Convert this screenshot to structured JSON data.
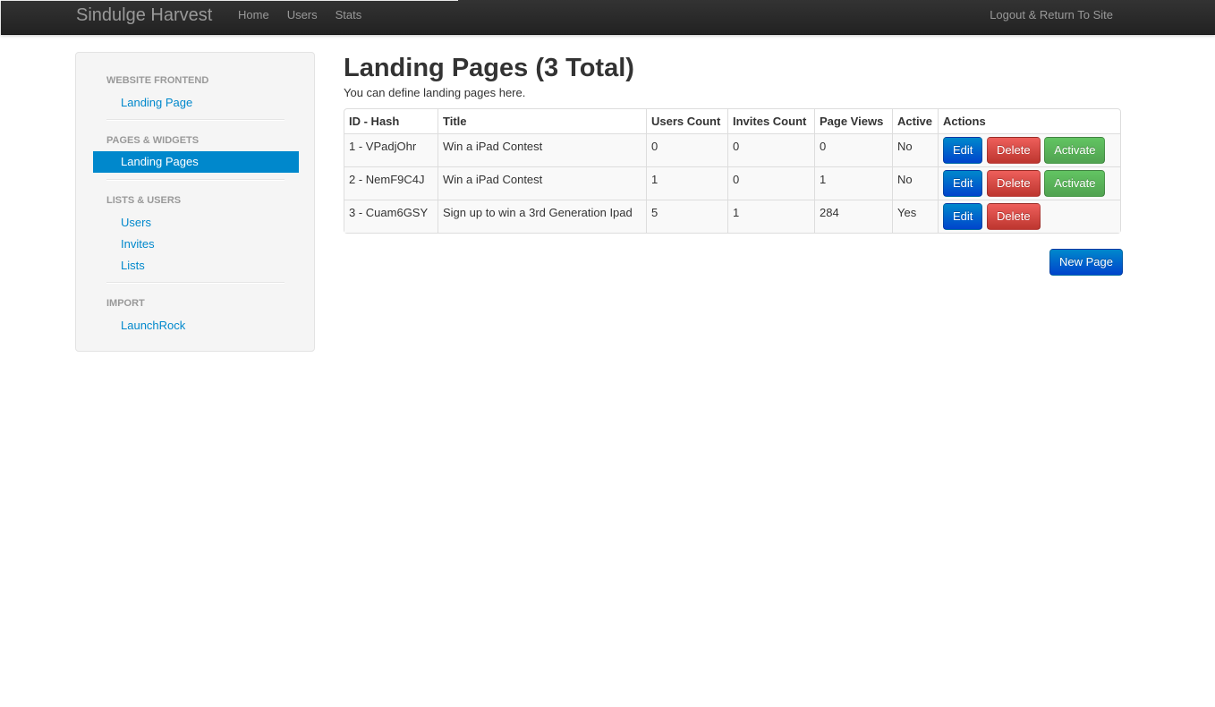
{
  "navbar": {
    "brand": "Sindulge Harvest",
    "links": [
      "Home",
      "Users",
      "Stats"
    ],
    "logout": "Logout & Return To Site"
  },
  "sidebar": {
    "section_frontend": "WEBSITE FRONTEND",
    "landing_page": "Landing Page",
    "section_pages": "PAGES & WIDGETS",
    "landing_pages": "Landing Pages",
    "section_lists": "LISTS & USERS",
    "users": "Users",
    "invites": "Invites",
    "lists": "Lists",
    "section_import": "IMPORT",
    "launchrock": "LaunchRock"
  },
  "main": {
    "title": "Landing Pages (3 Total)",
    "description": "You can define landing pages here.",
    "new_page_label": "New Page"
  },
  "table": {
    "headers": [
      "ID - Hash",
      "Title",
      "Users Count",
      "Invites Count",
      "Page Views",
      "Active",
      "Actions"
    ],
    "rows": [
      {
        "id": "1 - VPadjOhr",
        "title": "Win a iPad Contest",
        "users": "0",
        "invites": "0",
        "views": "0",
        "active": "No",
        "edit": "Edit",
        "delete": "Delete",
        "activate": "Activate"
      },
      {
        "id": "2 - NemF9C4J",
        "title": "Win a iPad Contest",
        "users": "1",
        "invites": "0",
        "views": "1",
        "active": "No",
        "edit": "Edit",
        "delete": "Delete",
        "activate": "Activate"
      },
      {
        "id": "3 - Cuam6GSY",
        "title": "Sign up to win a 3rd Generation Ipad",
        "users": "5",
        "invites": "1",
        "views": "284",
        "active": "Yes",
        "edit": "Edit",
        "delete": "Delete"
      }
    ]
  },
  "colors": {
    "link": "#0088cc",
    "primary": "#0074cc",
    "danger": "#da4f49",
    "success": "#5bb75b",
    "navbar": "#2c2c2c"
  }
}
